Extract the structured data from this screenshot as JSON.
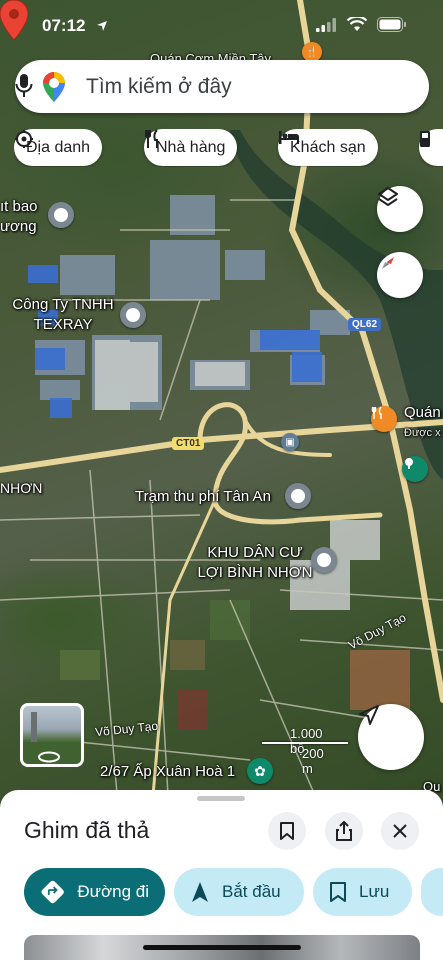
{
  "status": {
    "time": "07:12"
  },
  "search": {
    "placeholder": "Tìm kiếm ở đây"
  },
  "chips": [
    {
      "label": "Địa danh",
      "icon": "landmark-icon"
    },
    {
      "label": "Nhà hàng",
      "icon": "restaurant-icon"
    },
    {
      "label": "Khách sạn",
      "icon": "hotel-icon"
    }
  ],
  "map": {
    "labels": {
      "top_poi": "Quán Cơm Miền Tây",
      "left_poi_line1": "ıt bao",
      "left_poi_line2": "ương",
      "company_line1": "Công Ty TNHH",
      "company_line2": "TEXRAY",
      "right_poi_line1": "Quán",
      "right_poi_line2": "Được x",
      "toll": "Trạm thu phí Tân An",
      "nhon": "NHƠN",
      "residential_line1": "KHU DÂN CƯ",
      "residential_line2": "LỢI BÌNH NHƠN",
      "street_1": "Võ Duy Tạo",
      "street_2": "Võ Duy Tạo",
      "address": "2/67 Ấp Xuân Hoà 1",
      "edge_right": "Qu"
    },
    "road_tags": {
      "ql62": "QL62",
      "ct01": "CT01"
    },
    "scale": {
      "feet": "1.000 bộ",
      "meters": "200 m"
    }
  },
  "sheet": {
    "title": "Ghim đã thả",
    "actions": {
      "directions": "Đường đi",
      "start": "Bắt đầu",
      "save": "Lưu"
    }
  },
  "colors": {
    "primary": "#0b6d75",
    "secondary": "#c4eaf6",
    "pin": "#ea4335",
    "road": "#e8d59a"
  }
}
